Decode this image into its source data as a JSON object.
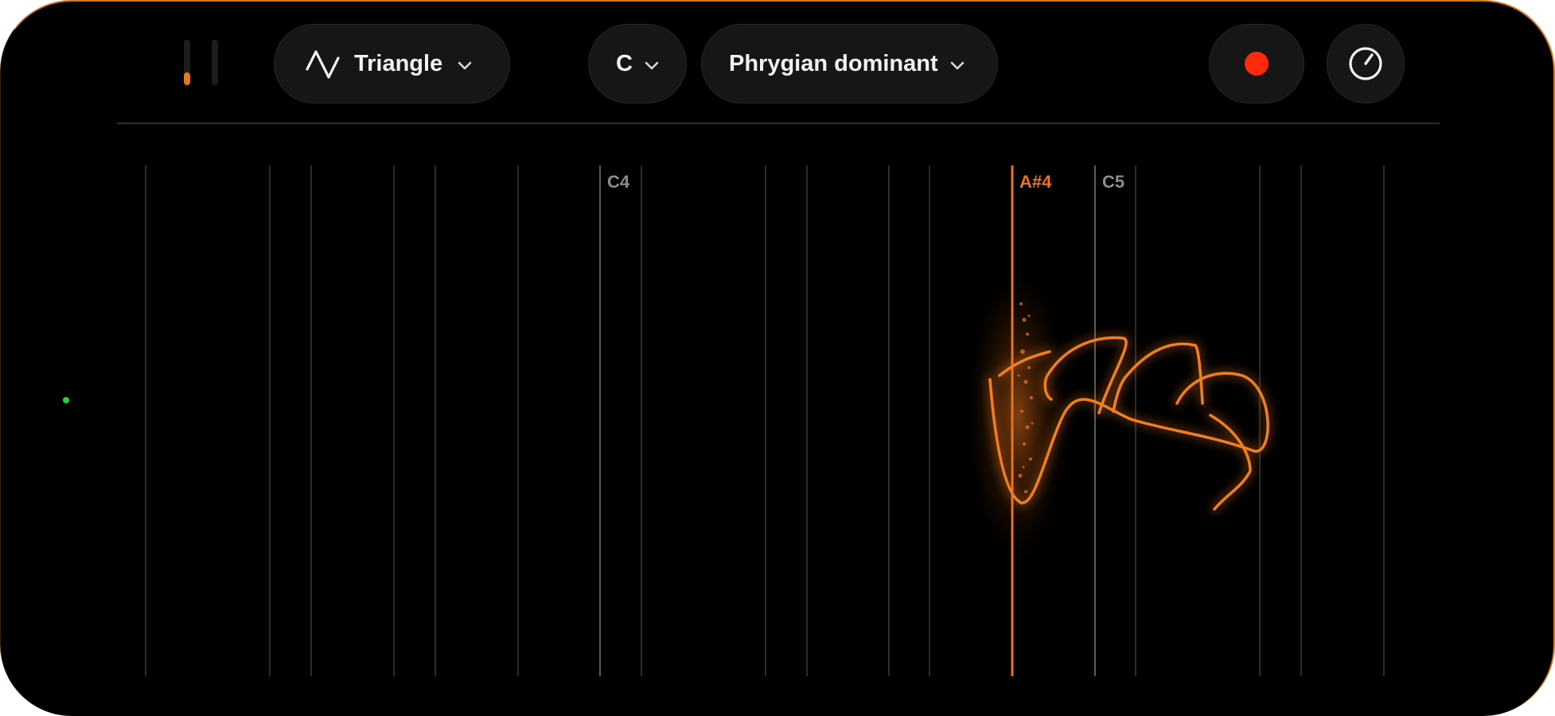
{
  "colors": {
    "accent": "#e8741c",
    "record": "#ff2a0d",
    "status": "#23d13a"
  },
  "level_meters": [
    {
      "name": "level-meter-left",
      "level": 0.28
    },
    {
      "name": "level-meter-right",
      "level": 0
    }
  ],
  "toolbar": {
    "waveform": {
      "icon": "triangle-wave-icon",
      "label": "Triangle"
    },
    "key": {
      "label": "C"
    },
    "scale": {
      "label": "Phrygian dominant"
    },
    "record": {
      "icon": "record-icon"
    },
    "settings": {
      "icon": "dial-icon"
    }
  },
  "keyboard": {
    "note_labels": {
      "c4": "C4",
      "a_sharp_4": "A#4",
      "c5": "C5"
    },
    "active_note": "A#4"
  },
  "status_indicator": {
    "icon": "green-dot-icon"
  }
}
